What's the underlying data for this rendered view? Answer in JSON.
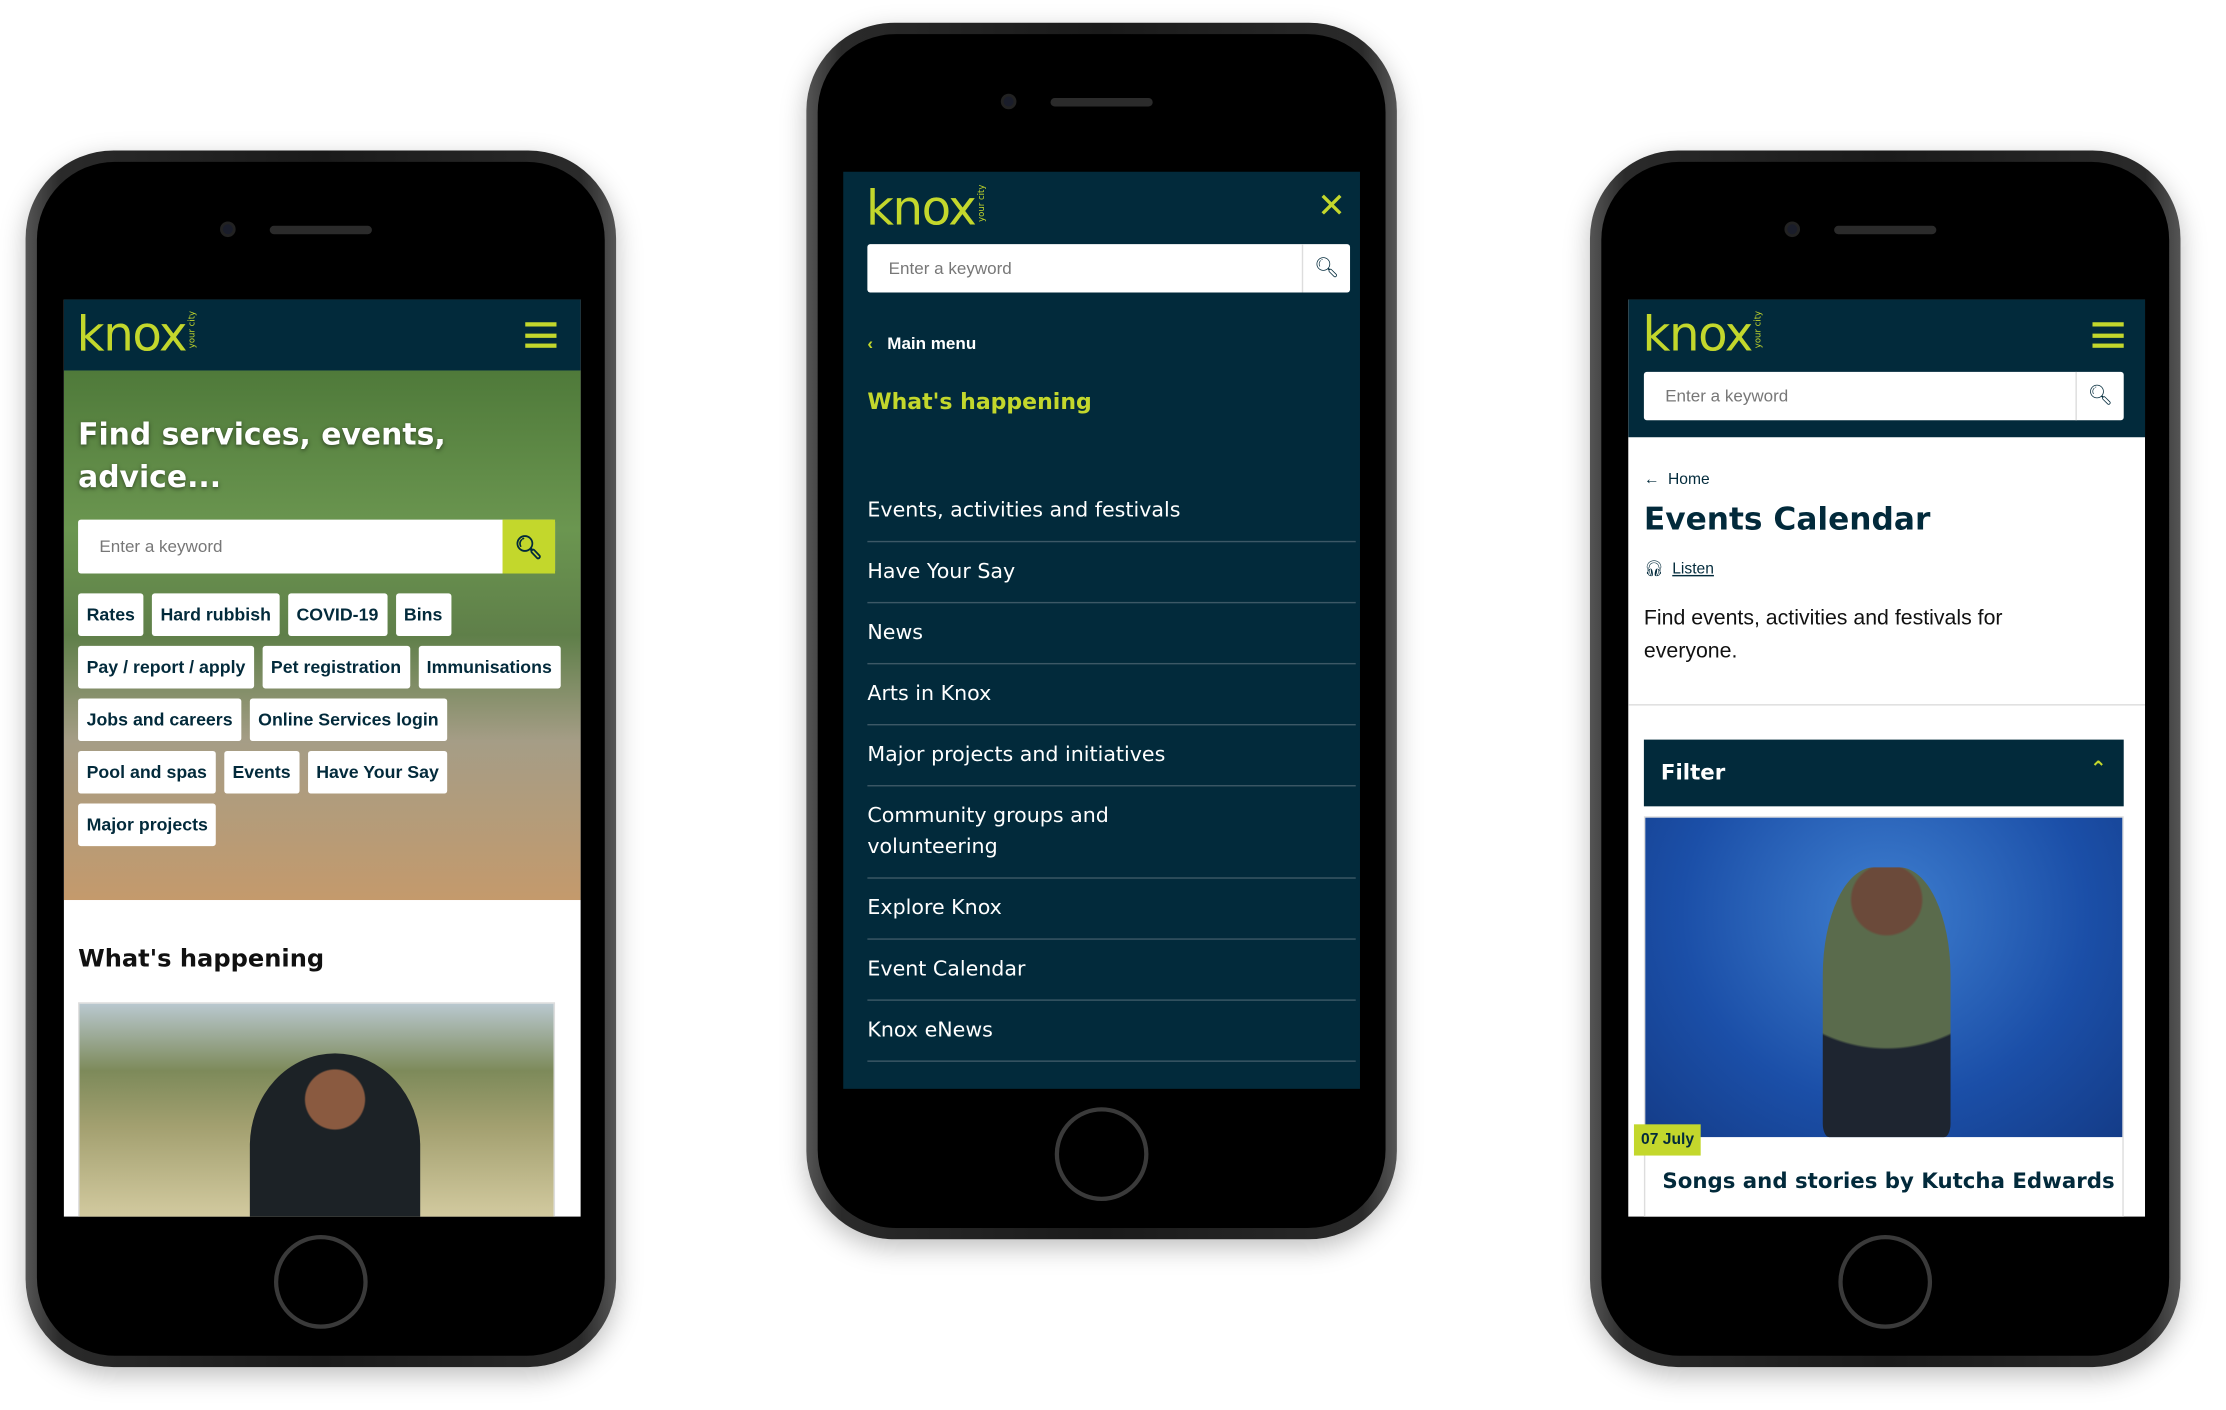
{
  "colors": {
    "navy": "#022a3b",
    "accent": "#c3d72c"
  },
  "brand": {
    "logo": "knox",
    "tagline": "your city"
  },
  "home_screen": {
    "hero_title": "Find services, events, advice...",
    "search_placeholder": "Enter a keyword",
    "quick_links": [
      "Rates",
      "Hard rubbish",
      "COVID-19",
      "Bins",
      "Pay / report / apply",
      "Pet registration",
      "Immunisations",
      "Jobs and careers",
      "Online Services login",
      "Pool and spas",
      "Events",
      "Have Your Say",
      "Major projects"
    ],
    "section_title": "What's happening"
  },
  "menu_screen": {
    "search_placeholder": "Enter a keyword",
    "back_label": "Main menu",
    "current_section": "What's happening",
    "items": [
      "Events, activities and festivals",
      "Have Your Say",
      "News",
      "Arts in Knox",
      "Major projects and initiatives",
      "Community groups and volunteering",
      "Explore Knox",
      "Event Calendar",
      "Knox eNews"
    ]
  },
  "events_screen": {
    "search_placeholder": "Enter a keyword",
    "breadcrumb": "Home",
    "title": "Events Calendar",
    "listen": "Listen",
    "description": "Find events, activities and festivals for everyone.",
    "filter_label": "Filter",
    "event": {
      "date": "07 July",
      "title": "Songs and stories by Kutcha Edwards"
    }
  }
}
